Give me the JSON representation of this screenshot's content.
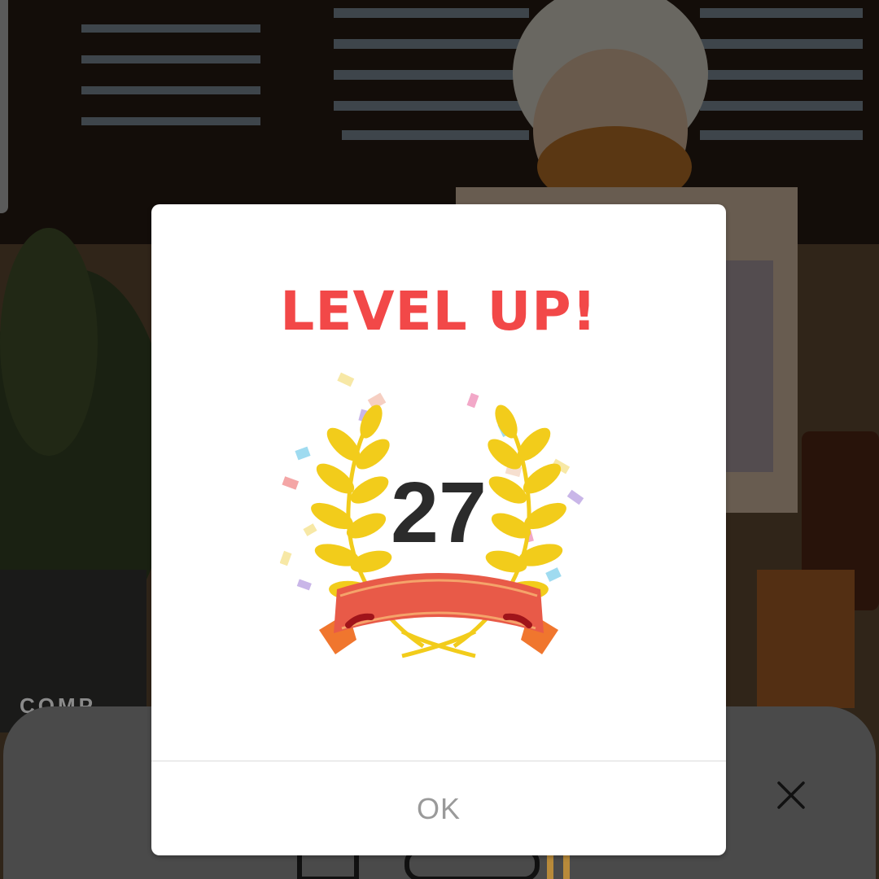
{
  "dialog": {
    "title": "LEVEL UP!",
    "level": "27",
    "ok_label": "OK"
  },
  "background_sheet": {
    "peek_text": "COMP"
  },
  "colors": {
    "title_red": "#f24848",
    "laurel_gold": "#f2cc1b",
    "ribbon_red": "#e85a48",
    "ribbon_orange": "#f0762e",
    "ok_gray": "#9a9a9a"
  },
  "icons": [
    "laurel-wreath-icon",
    "ribbon-banner-icon",
    "confetti-icon",
    "close-icon"
  ]
}
